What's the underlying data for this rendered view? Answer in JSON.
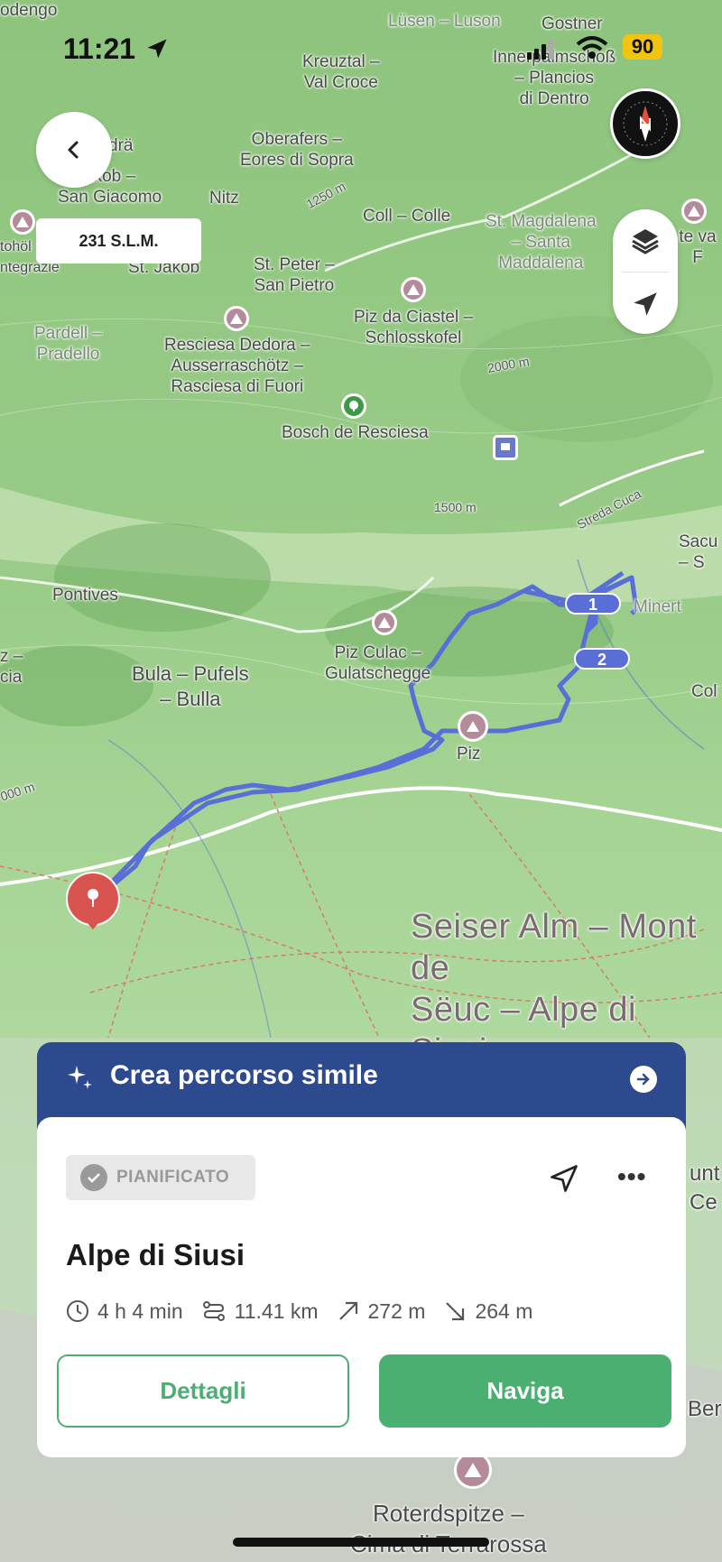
{
  "status_bar": {
    "time": "11:21",
    "battery": "90"
  },
  "elevation_label": "231 S.L.M.",
  "map": {
    "place_labels": [
      {
        "text": "odengo"
      },
      {
        "text": "Lüsen – Luson"
      },
      {
        "text": "Gostner"
      },
      {
        "text": "Kreuztal –\nVal Croce"
      },
      {
        "text": "Innerpalmschoß\n– Plancios\ndi Dentro"
      },
      {
        "text": "drä"
      },
      {
        "text": "akob –\nSan Giacomo"
      },
      {
        "text": "Oberafers –\nEores di Sopra"
      },
      {
        "text": "Nitz"
      },
      {
        "text": "1250 m"
      },
      {
        "text": "Coll – Colle"
      },
      {
        "text": "St. Magdalena\n– Santa\nMaddalena"
      },
      {
        "text": "te va F"
      },
      {
        "text": "tohöl\nntegrazie"
      },
      {
        "text": "St. Jakob"
      },
      {
        "text": "St. Peter –\nSan Pietro"
      },
      {
        "text": "Piz da Ciastel –\nSchlosskofel"
      },
      {
        "text": "Pardell –\nPradello"
      },
      {
        "text": "Resciesa Dedora –\nAusserraschötz –\nRasciesa di Fuori"
      },
      {
        "text": "2000 m"
      },
      {
        "text": "Bosch de Resciesa"
      },
      {
        "text": "1500 m"
      },
      {
        "text": "Streda Cuca"
      },
      {
        "text": "Sacu\n– S"
      },
      {
        "text": "Pontives"
      },
      {
        "text": "Minert"
      },
      {
        "text": "z –\ncia"
      },
      {
        "text": "Bula – Pufels\n– Bulla"
      },
      {
        "text": "Piz Culac –\nGulatschegge"
      },
      {
        "text": "Col"
      },
      {
        "text": "Piz"
      },
      {
        "text": "000 m"
      },
      {
        "text": "Seiser Alm – Mont de\nSëuc – Alpe di Siusi"
      },
      {
        "text": "unt\nCe"
      },
      {
        "text": "Ber"
      },
      {
        "text": "Roterdspitze –\nCima di Terrarossa"
      }
    ],
    "route_waypoints": [
      "1",
      "2"
    ]
  },
  "banner": {
    "label": "Crea percorso simile"
  },
  "route_card": {
    "badge": "PIANIFICATO",
    "title": "Alpe di Siusi",
    "duration": "4 h 4 min",
    "distance": "11.41 km",
    "ascent": "272 m",
    "descent": "264 m",
    "details_button": "Dettagli",
    "navigate_button": "Naviga",
    "more_label": "•••"
  },
  "colors": {
    "route": "#5a6fd6",
    "accent_green": "#4caf72",
    "banner_blue": "#2e4a8e",
    "poi": "#b48b9a",
    "start_marker": "#d9534f"
  }
}
